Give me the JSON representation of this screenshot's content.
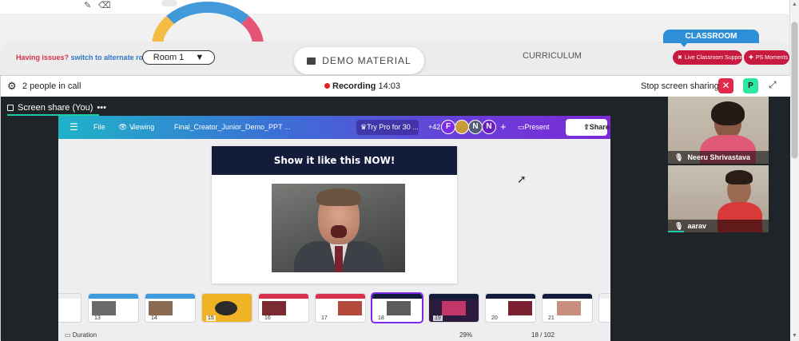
{
  "issues": {
    "prefix": "Having issues?",
    "link": "switch to alternate room"
  },
  "room": {
    "label": "Room 1"
  },
  "demo_material": "DEMO MATERIAL",
  "curriculum": "CURRICULUM",
  "classroom": "CLASSROOM",
  "pills": {
    "live_support": "Live Classroom Support",
    "ps_moments": "PS Moments"
  },
  "call": {
    "people": "2 people in call",
    "recording_label": "Recording",
    "recording_time": "14:03",
    "stop_sharing": "Stop screen sharing",
    "user_initial": "P"
  },
  "screen_share_tab": "Screen share (You)",
  "canva": {
    "file": "File",
    "viewing": "Viewing",
    "file_name": "Final_Creator_Junior_Demo_PPT ...",
    "try_pro": "Try Pro for 30 ...",
    "extra_collaborators": "+42",
    "avatars": [
      "F",
      "",
      "N",
      "N"
    ],
    "present": "Present",
    "share": "Share",
    "slide_title": "Show it like this NOW!",
    "thumbnails": [
      "13",
      "14",
      "15",
      "16",
      "17",
      "18",
      "19",
      "20",
      "21"
    ],
    "selected_thumbnail": "18",
    "footer_left": "Duration",
    "zoom": "29%",
    "page_indicator": "18 / 102"
  },
  "participants": [
    {
      "name": "Neeru Shrivastava (You)"
    },
    {
      "name": "aarav"
    }
  ],
  "colors": {
    "accent": "#1ec9a8",
    "danger": "#e0294b",
    "canva_purple": "#7d2ae8"
  }
}
